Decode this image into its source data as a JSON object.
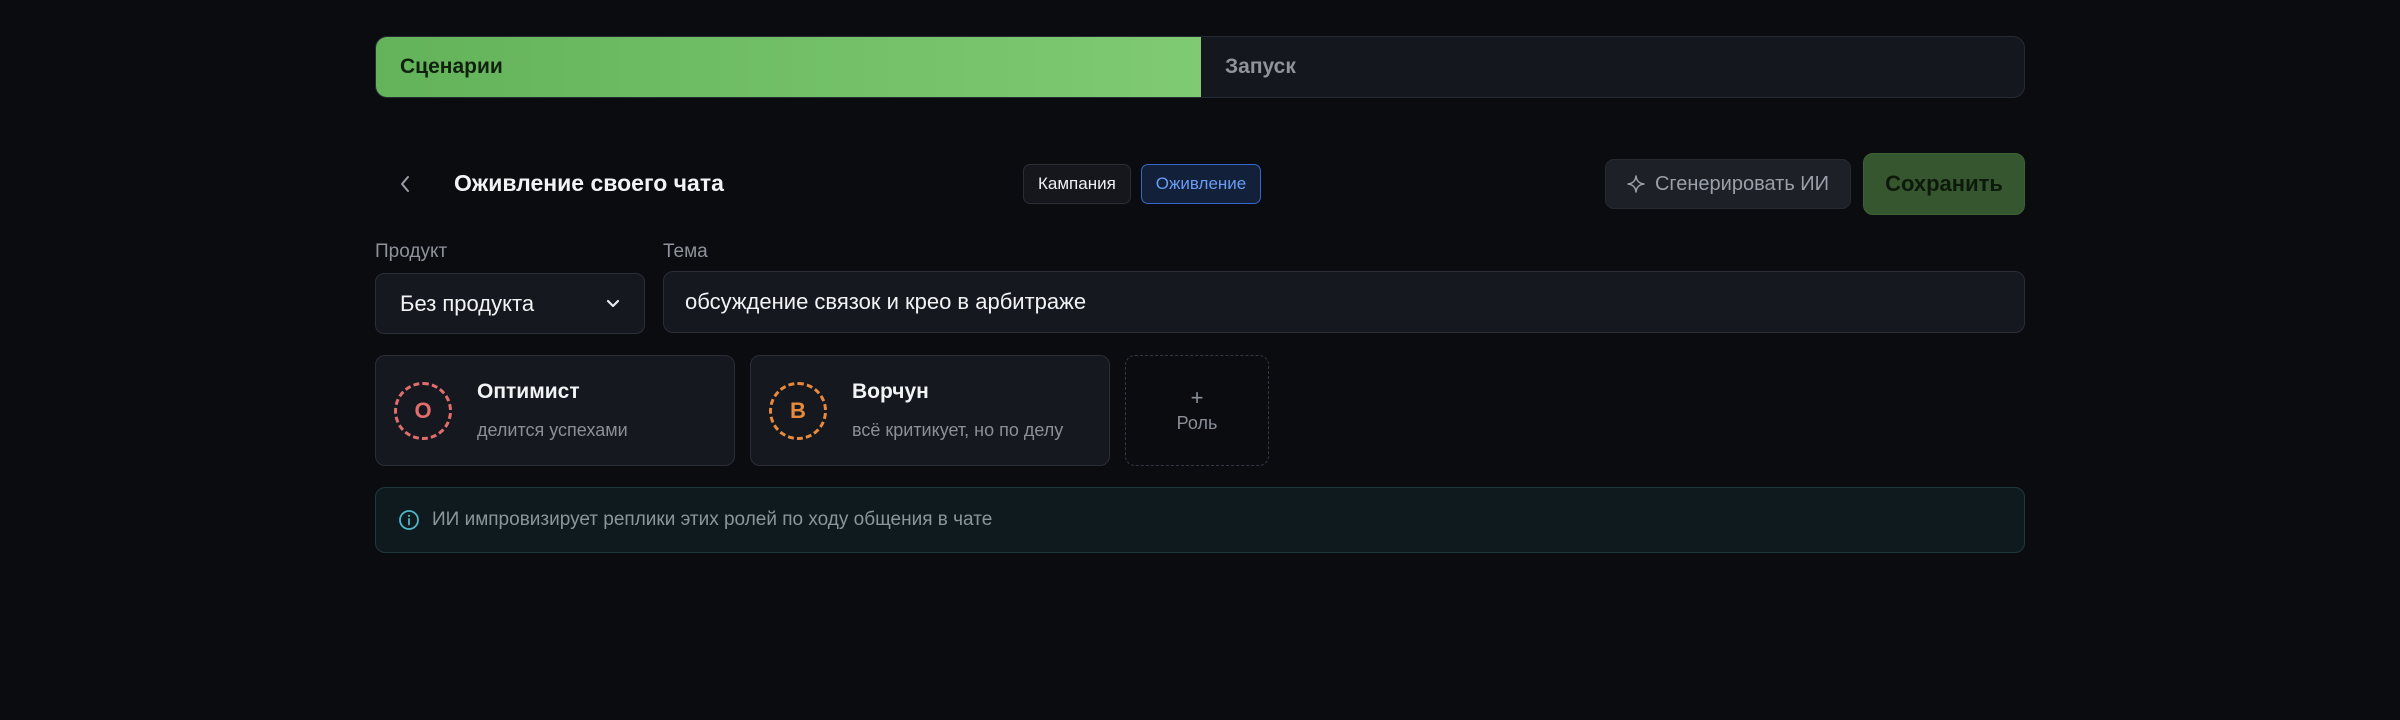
{
  "tabs": [
    {
      "label": "Сценарии",
      "active": true
    },
    {
      "label": "Запуск",
      "active": false
    }
  ],
  "header": {
    "title": "Оживление своего чата",
    "modes": [
      {
        "label": "Кампания",
        "selected": false
      },
      {
        "label": "Оживление",
        "selected": true
      }
    ],
    "generate_label": "Сгенерировать ИИ",
    "save_label": "Сохранить"
  },
  "form": {
    "product_label": "Продукт",
    "product_value": "Без продукта",
    "topic_label": "Тема",
    "topic_value": "обсуждение связок и крео в арбитраже"
  },
  "roles": [
    {
      "initial": "О",
      "name": "Оптимист",
      "description": "делится успехами",
      "color": "#e26d6d"
    },
    {
      "initial": "В",
      "name": "Ворчун",
      "description": "всё критикует, но по делу",
      "color": "#e88a3c"
    }
  ],
  "add_role": {
    "plus": "+",
    "label": "Роль"
  },
  "info": {
    "text": "ИИ импровизирует реплики этих ролей по ходу общения в чате",
    "icon": "info-icon"
  },
  "colors": {
    "accent_green": "#7fca73",
    "save_green": "#36562f",
    "selected_blue": "#6a9cf3",
    "info_cyan": "#4fb6c9"
  }
}
